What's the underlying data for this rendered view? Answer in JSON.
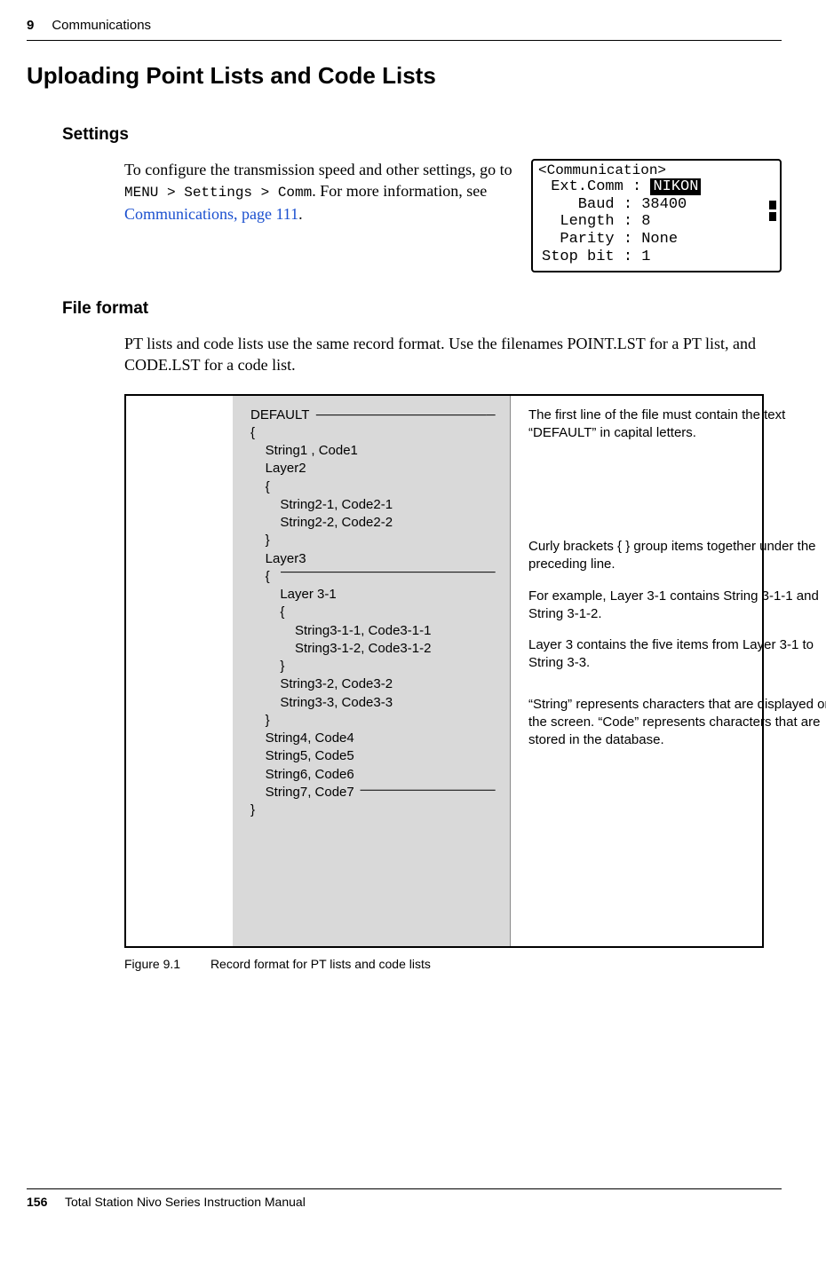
{
  "header": {
    "chapter_number": "9",
    "chapter_title": "Communications"
  },
  "title": "Uploading Point Lists and Code Lists",
  "settings": {
    "heading": "Settings",
    "para_lead": "To configure the transmission speed and other settings, go to ",
    "menu_path": "MENU > Settings > Comm",
    "para_tail": ". For more information, see ",
    "link_text": "Communications, page 111",
    "period": "."
  },
  "lcd": {
    "title": "<Communication>",
    "l1_label": "Ext.Comm :",
    "l1_val": "NIKON",
    "l2": "    Baud : 38400",
    "l3": "  Length : 8",
    "l4": "  Parity : None",
    "l5": "Stop bit : 1"
  },
  "fileformat": {
    "heading": "File format",
    "para": "PT lists and code lists use the same record format. Use the filenames POINT.LST for a PT list, and CODE.LST for a code list."
  },
  "code_listing": "DEFAULT\n{\n    String1 , Code1\n    Layer2\n    {\n        String2-1, Code2-1\n        String2-2, Code2-2\n    }\n    Layer3\n    {\n        Layer 3-1\n        {\n            String3-1-1, Code3-1-1\n            String3-1-2, Code3-1-2\n        }\n        String3-2, Code3-2\n        String3-3, Code3-3\n    }\n    String4, Code4\n    String5, Code5\n    String6, Code6\n    String7, Code7\n}",
  "annotations": {
    "a1": "The first line of the file must contain the text “DEFAULT” in capital letters.",
    "a2": "Curly brackets { } group items together under the preceding line.",
    "a2b": "For example, Layer 3-1 contains String 3-1-1 and String 3-1-2.",
    "a2c": "Layer 3 contains the five items from Layer 3-1 to String 3-3.",
    "a3": "“String” represents characters that are displayed on the screen. “Code” represents characters that are stored in the database."
  },
  "figure": {
    "num": "Figure 9.1",
    "caption": "Record format for PT lists and code lists"
  },
  "footer": {
    "page": "156",
    "book": "Total Station Nivo Series Instruction Manual"
  }
}
